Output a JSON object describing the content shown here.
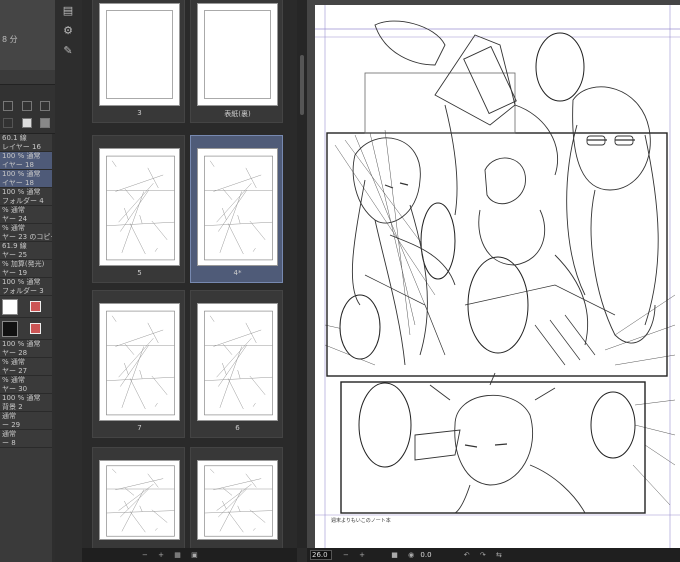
{
  "layer_panel": {
    "time_label": "8 分",
    "opacity_value": "100",
    "layers": [
      {
        "line1": "60.1 線",
        "line2": "レイヤー 16",
        "selected": false
      },
      {
        "line1": "100 % 通常",
        "line2": "イヤー 18",
        "selected": true
      },
      {
        "line1": "100 % 通常",
        "line2": "イヤー 18",
        "selected": true
      },
      {
        "line1": "100 % 通常",
        "line2": "フォルダー 4",
        "selected": false
      },
      {
        "line1": "% 通常",
        "line2": "ヤー 24",
        "selected": false
      },
      {
        "line1": "% 通常",
        "line2": "ヤー 23 のコピー",
        "selected": false
      },
      {
        "line1": "61.9 線",
        "line2": "ヤー 25",
        "selected": false
      },
      {
        "line1": "% 加算(発光)",
        "line2": "ヤー 19",
        "selected": false
      },
      {
        "line1": "100 % 通常",
        "line2": "フォルダー 3",
        "selected": false
      },
      {
        "line1": "",
        "line2": "",
        "selected": false
      },
      {
        "line1": "",
        "line2": "",
        "selected": false
      },
      {
        "line1": "100 % 通常",
        "line2": "ヤー 28",
        "selected": false
      },
      {
        "line1": "% 通常",
        "line2": "ヤー 27",
        "selected": false
      },
      {
        "line1": "% 通常",
        "line2": "ヤー 30",
        "selected": false
      },
      {
        "line1": "100 % 通常",
        "line2": "背景 2",
        "selected": false
      },
      {
        "line1": "通常",
        "line2": "ー 29",
        "selected": false
      },
      {
        "line1": "通常",
        "line2": "ー 8",
        "selected": false
      }
    ]
  },
  "page_manager": {
    "pages": [
      {
        "label": "3",
        "selected": false
      },
      {
        "label": "表紙(裏)",
        "selected": false
      },
      {
        "label": "5",
        "selected": false
      },
      {
        "label": "4*",
        "selected": true
      },
      {
        "label": "7",
        "selected": false
      },
      {
        "label": "6",
        "selected": false
      },
      {
        "label": "",
        "selected": false
      },
      {
        "label": "",
        "selected": false
      }
    ]
  },
  "canvas": {
    "signature": "週末よりもいこのノート本"
  },
  "status": {
    "zoom": "26.0",
    "zoom2": "0.0",
    "minus": "−",
    "plus": "+"
  }
}
